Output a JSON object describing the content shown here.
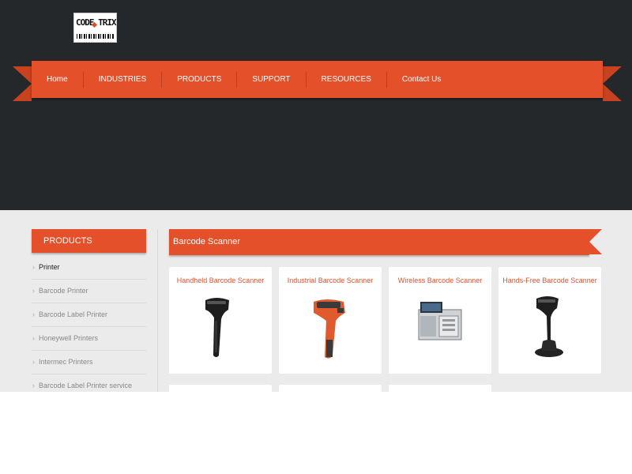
{
  "brand": {
    "logo_text": "CODE TRIX"
  },
  "nav": {
    "items": [
      "Home",
      "INDUSTRIES",
      "PRODUCTS",
      "SUPPORT",
      "RESOURCES",
      "Contact Us"
    ]
  },
  "sidebar": {
    "title": "PRODUCTS",
    "items": [
      {
        "label": "Printer",
        "active": true
      },
      {
        "label": "Barcode Printer",
        "active": false
      },
      {
        "label": "Barcode Label Printer",
        "active": false
      },
      {
        "label": "Honeywell Printers",
        "active": false
      },
      {
        "label": "Intermec Printers",
        "active": false
      },
      {
        "label": "Barcode Label Printer service",
        "active": false
      }
    ]
  },
  "main": {
    "title": "Barcode Scanner",
    "products": [
      {
        "name": "Handheld Barcode Scanner",
        "icon": "handheld-scanner-icon"
      },
      {
        "name": "Industrial Barcode Scanner",
        "icon": "industrial-scanner-icon"
      },
      {
        "name": "Wireless Barcode Scanner",
        "icon": "countertop-scanner-icon"
      },
      {
        "name": "Hands-Free Barcode Scanner",
        "icon": "handsfree-scanner-icon"
      }
    ]
  },
  "colors": {
    "accent": "#e4502a",
    "header_bg": "#25282b",
    "content_bg": "#ebebeb"
  }
}
